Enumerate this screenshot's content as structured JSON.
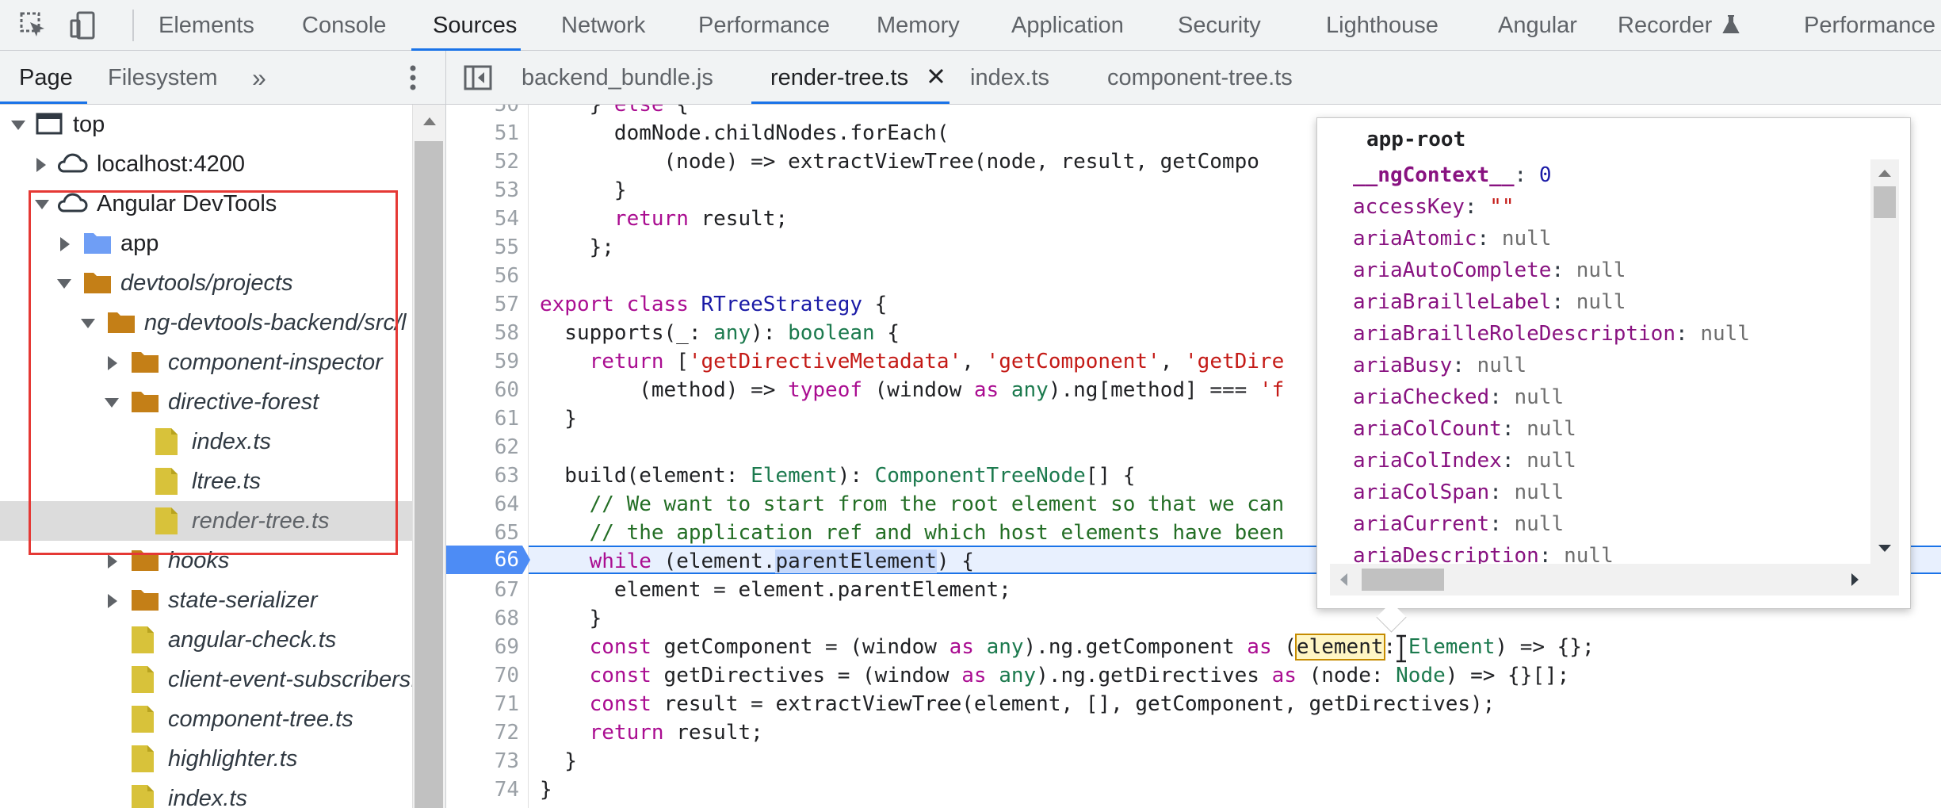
{
  "toolbar": {
    "tabs": [
      "Elements",
      "Console",
      "Sources",
      "Network",
      "Performance",
      "Memory",
      "Application",
      "Security",
      "Lighthouse",
      "Angular",
      "Recorder",
      "Performance"
    ],
    "active_tab": "Sources",
    "icons": [
      "inspect-element-icon",
      "device-toolbar-icon",
      "flask-icon"
    ]
  },
  "navigator": {
    "tabs": [
      "Page",
      "Filesystem"
    ],
    "more": "»",
    "tree": [
      {
        "label": "top",
        "icon": "frame-icon",
        "expanded": true
      },
      {
        "label": "localhost:4200",
        "icon": "cloud-icon",
        "expanded": false
      },
      {
        "label": "Angular DevTools",
        "icon": "cloud-icon",
        "expanded": true
      },
      {
        "label": "app",
        "icon": "folder-blue-icon",
        "expanded": false
      },
      {
        "label": "devtools/projects",
        "icon": "folder-icon",
        "expanded": true
      },
      {
        "label": "ng-devtools-backend/src/l",
        "icon": "folder-icon",
        "expanded": true
      },
      {
        "label": "component-inspector",
        "icon": "folder-icon",
        "expanded": false
      },
      {
        "label": "directive-forest",
        "icon": "folder-icon",
        "expanded": true
      },
      {
        "label": "index.ts",
        "icon": "file-icon"
      },
      {
        "label": "ltree.ts",
        "icon": "file-icon"
      },
      {
        "label": "render-tree.ts",
        "icon": "file-icon",
        "selected": true
      },
      {
        "label": "hooks",
        "icon": "folder-icon",
        "expanded": false
      },
      {
        "label": "state-serializer",
        "icon": "folder-icon",
        "expanded": false
      },
      {
        "label": "angular-check.ts",
        "icon": "file-icon"
      },
      {
        "label": "client-event-subscribers.",
        "icon": "file-icon"
      },
      {
        "label": "component-tree.ts",
        "icon": "file-icon"
      },
      {
        "label": "highlighter.ts",
        "icon": "file-icon"
      },
      {
        "label": "index.ts",
        "icon": "file-icon"
      }
    ]
  },
  "editor": {
    "tabs": [
      "backend_bundle.js",
      "render-tree.ts",
      "index.ts",
      "component-tree.ts"
    ],
    "active_tab": "render-tree.ts",
    "close_icon": "×",
    "breakpoint_line": "66",
    "lines": [
      {
        "n": "50",
        "code": "    } else {"
      },
      {
        "n": "51",
        "code": "      domNode.childNodes.forEach("
      },
      {
        "n": "52",
        "code": "          (node) => extractViewTree(node, result, getCompo"
      },
      {
        "n": "53",
        "code": "      }"
      },
      {
        "n": "54",
        "code": "      return result;"
      },
      {
        "n": "55",
        "code": "    };"
      },
      {
        "n": "56",
        "code": ""
      },
      {
        "n": "57",
        "code": "export class RTreeStrategy {"
      },
      {
        "n": "58",
        "code": "  supports(_: any): boolean {"
      },
      {
        "n": "59",
        "code": "    return ['getDirectiveMetadata', 'getComponent', 'getDire"
      },
      {
        "n": "60",
        "code": "        (method) => typeof (window as any).ng[method] === 'f"
      },
      {
        "n": "61",
        "code": "  }"
      },
      {
        "n": "62",
        "code": ""
      },
      {
        "n": "63",
        "code": "  build(element: Element): ComponentTreeNode[] {"
      },
      {
        "n": "64",
        "code": "    // We want to start from the root element so that we can"
      },
      {
        "n": "65",
        "code": "    // the application ref and which host elements have been"
      },
      {
        "n": "66",
        "code": "    while (element.parentElement) {"
      },
      {
        "n": "67",
        "code": "      element = element.parentElement;"
      },
      {
        "n": "68",
        "code": "    }"
      },
      {
        "n": "69",
        "code": "    const getComponent = (window as any).ng.getComponent as (element: Element) => {};"
      },
      {
        "n": "70",
        "code": "    const getDirectives = (window as any).ng.getDirectives as (node: Node) => {}[];"
      },
      {
        "n": "71",
        "code": "    const result = extractViewTree(element, [], getComponent, getDirectives);"
      },
      {
        "n": "72",
        "code": "    return result;"
      },
      {
        "n": "73",
        "code": "  }"
      },
      {
        "n": "74",
        "code": "}"
      }
    ]
  },
  "popover": {
    "title": "app-root",
    "properties": [
      {
        "key": "__ngContext__",
        "value": "0",
        "kind": "num"
      },
      {
        "key": "accessKey",
        "value": "\"\"",
        "kind": "str"
      },
      {
        "key": "ariaAtomic",
        "value": "null",
        "kind": "null"
      },
      {
        "key": "ariaAutoComplete",
        "value": "null",
        "kind": "null"
      },
      {
        "key": "ariaBrailleLabel",
        "value": "null",
        "kind": "null"
      },
      {
        "key": "ariaBrailleRoleDescription",
        "value": "null",
        "kind": "null"
      },
      {
        "key": "ariaBusy",
        "value": "null",
        "kind": "null"
      },
      {
        "key": "ariaChecked",
        "value": "null",
        "kind": "null"
      },
      {
        "key": "ariaColCount",
        "value": "null",
        "kind": "null"
      },
      {
        "key": "ariaColIndex",
        "value": "null",
        "kind": "null"
      },
      {
        "key": "ariaColSpan",
        "value": "null",
        "kind": "null"
      },
      {
        "key": "ariaCurrent",
        "value": "null",
        "kind": "null"
      },
      {
        "key": "ariaDescription",
        "value": "null",
        "kind": "null"
      }
    ]
  },
  "colors": {
    "accent": "#1a73e8",
    "folder": "#c47f17",
    "folder_blue": "#6f9ef5",
    "file": "#d8c23a",
    "highlight_box": "#e53935"
  }
}
